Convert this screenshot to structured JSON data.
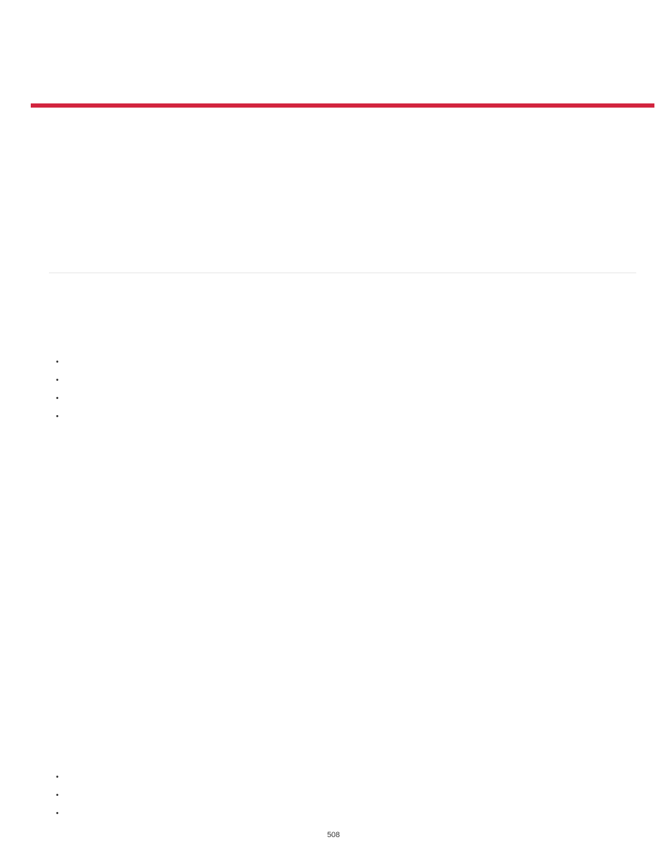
{
  "page": {
    "number": "508"
  },
  "bullets_top": [
    "",
    "",
    "",
    ""
  ],
  "bullets_bottom": [
    "",
    "",
    ""
  ]
}
